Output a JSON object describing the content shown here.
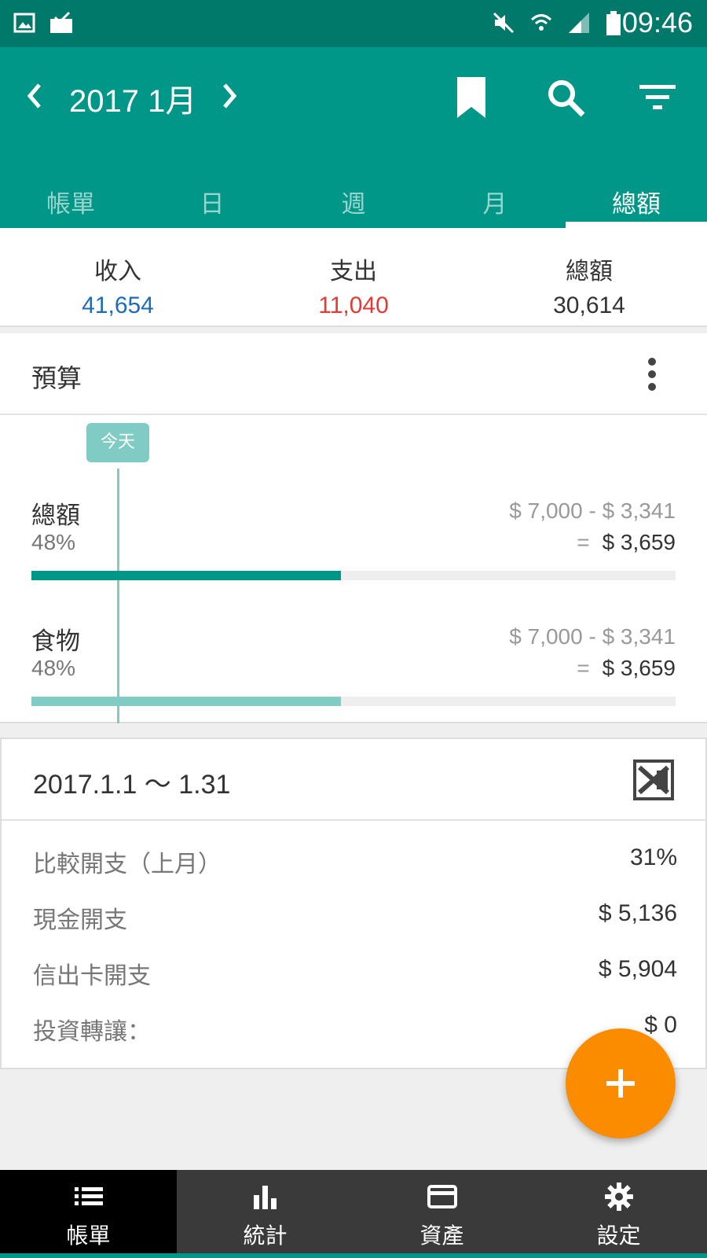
{
  "status_bar": {
    "time": "09:46",
    "left_icons": [
      "gallery-icon",
      "mail-check-icon"
    ],
    "right_icons": [
      "mute-icon",
      "wifi-icon",
      "signal-icon",
      "battery-icon"
    ]
  },
  "header": {
    "title": "2017 1月",
    "actions": [
      "bookmark-icon",
      "search-icon",
      "filter-icon"
    ],
    "color": "#009688"
  },
  "tabs": [
    {
      "label": "帳單",
      "active": false
    },
    {
      "label": "日",
      "active": false
    },
    {
      "label": "週",
      "active": false
    },
    {
      "label": "月",
      "active": false
    },
    {
      "label": "總額",
      "active": true
    }
  ],
  "summary": {
    "income": {
      "label": "收入",
      "value": "41,654",
      "color": "#1e6bb8"
    },
    "expense": {
      "label": "支出",
      "value": "11,040",
      "color": "#e53935"
    },
    "total": {
      "label": "總額",
      "value": "30,614",
      "color": "#333333"
    }
  },
  "budget": {
    "title": "預算",
    "today_label": "今天",
    "items": [
      {
        "name": "總額",
        "percent": "48%",
        "calc": "$ 7,000  - $ 3,341",
        "eq": "=",
        "result": "$ 3,659",
        "fill": 0.48,
        "color": "#009688"
      },
      {
        "name": "食物",
        "percent": "48%",
        "calc": "$ 7,000  - $ 3,341",
        "eq": "=",
        "result": "$ 3,659",
        "fill": 0.48,
        "color": "#80cbc4"
      }
    ]
  },
  "period": {
    "range": "2017.1.1  ～  1.31",
    "rows": [
      {
        "label": "比較開支（上月）",
        "value": "31%"
      },
      {
        "label": "現金開支",
        "value": "$ 5,136"
      },
      {
        "label": "信出卡開支",
        "value": "$ 5,904"
      },
      {
        "label": "投資轉讓：",
        "value": "$ 0"
      }
    ]
  },
  "fab": {
    "icon": "plus-icon",
    "color": "#fb8c00"
  },
  "bottom_nav": [
    {
      "label": "帳單",
      "icon": "list-icon",
      "active": true
    },
    {
      "label": "統計",
      "icon": "bar-chart-icon",
      "active": false
    },
    {
      "label": "資產",
      "icon": "card-icon",
      "active": false
    },
    {
      "label": "設定",
      "icon": "gear-icon",
      "active": false
    }
  ]
}
